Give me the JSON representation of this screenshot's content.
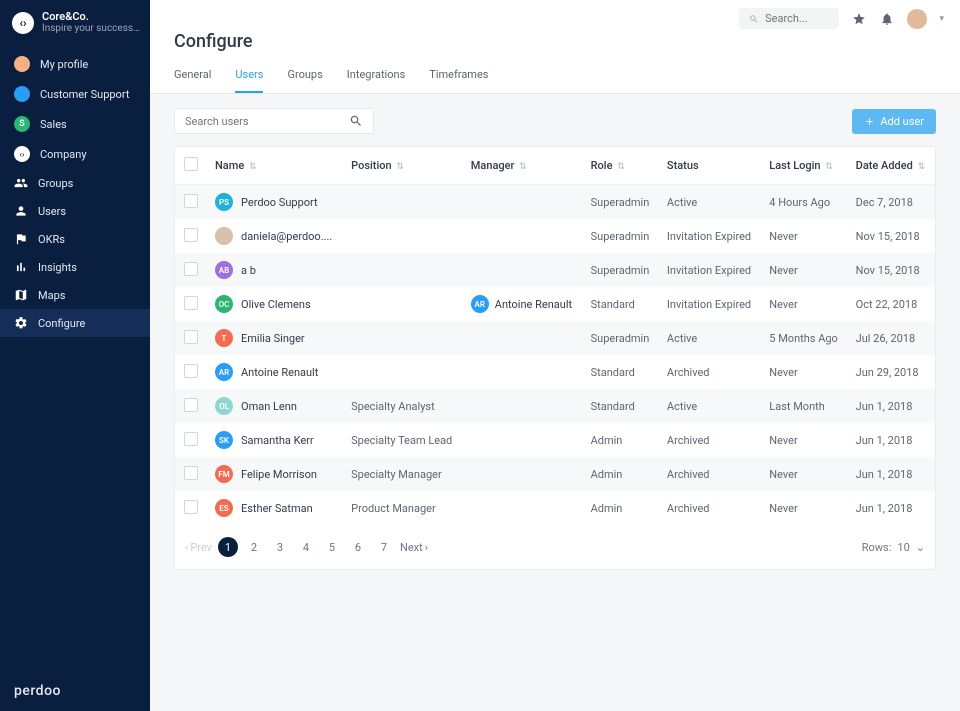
{
  "brand": {
    "name": "Core&Co.",
    "tagline": "Inspire your success ..."
  },
  "sidebar": {
    "items": [
      {
        "label": "My profile",
        "kind": "avatar"
      },
      {
        "label": "Customer Support",
        "kind": "badge",
        "badge_color": "#2a9df4"
      },
      {
        "label": "Sales",
        "kind": "badge",
        "badge_color": "#2bb673",
        "badge_letter": "S"
      },
      {
        "label": "Company",
        "kind": "logo"
      },
      {
        "label": "Groups",
        "kind": "icon",
        "icon": "groups"
      },
      {
        "label": "Users",
        "kind": "icon",
        "icon": "user"
      },
      {
        "label": "OKRs",
        "kind": "icon",
        "icon": "flag"
      },
      {
        "label": "Insights",
        "kind": "icon",
        "icon": "chart"
      },
      {
        "label": "Maps",
        "kind": "icon",
        "icon": "map"
      },
      {
        "label": "Configure",
        "kind": "icon",
        "icon": "gear",
        "active": true
      }
    ],
    "footer_logo": "perdoo"
  },
  "topbar": {
    "search_placeholder": "Search..."
  },
  "page": {
    "title": "Configure"
  },
  "tabs": [
    {
      "label": "General"
    },
    {
      "label": "Users",
      "active": true
    },
    {
      "label": "Groups"
    },
    {
      "label": "Integrations"
    },
    {
      "label": "Timeframes"
    }
  ],
  "toolbar": {
    "search_placeholder": "Search users",
    "add_button_label": "Add user"
  },
  "columns": [
    "Name",
    "Position",
    "Manager",
    "Role",
    "Status",
    "Last Login",
    "Date Added"
  ],
  "sortable": [
    true,
    true,
    true,
    true,
    false,
    true,
    true
  ],
  "rows": [
    {
      "avatar": "#20b0d8",
      "initials": "PS",
      "name": "Perdoo Support",
      "position": "",
      "manager": "",
      "mgr_avatar": "",
      "role": "Superadmin",
      "status": "Active",
      "last_login": "4 Hours Ago",
      "date_added": "Dec 7, 2018"
    },
    {
      "avatar": "photo",
      "initials": "",
      "name": "daniela@perdoo....",
      "position": "",
      "manager": "",
      "mgr_avatar": "",
      "role": "Superadmin",
      "status": "Invitation Expired",
      "last_login": "Never",
      "date_added": "Nov 15, 2018"
    },
    {
      "avatar": "#9d6fe0",
      "initials": "AB",
      "name": "a b",
      "position": "",
      "manager": "",
      "mgr_avatar": "",
      "role": "Superadmin",
      "status": "Invitation Expired",
      "last_login": "Never",
      "date_added": "Nov 15, 2018"
    },
    {
      "avatar": "#2bb673",
      "initials": "OC",
      "name": "Olive Clemens",
      "position": "",
      "manager": "Antoine Renault",
      "mgr_avatar": "#2a9df4",
      "mgr_initials": "AR",
      "role": "Standard",
      "status": "Invitation Expired",
      "last_login": "Never",
      "date_added": "Oct 22, 2018"
    },
    {
      "avatar": "#f26d50",
      "initials": "T",
      "name": "Emilia Singer",
      "position": "",
      "manager": "",
      "mgr_avatar": "",
      "role": "Superadmin",
      "status": "Active",
      "last_login": "5 Months Ago",
      "date_added": "Jul 26, 2018"
    },
    {
      "avatar": "#2a9df4",
      "initials": "AR",
      "name": "Antoine Renault",
      "position": "",
      "manager": "",
      "mgr_avatar": "",
      "role": "Standard",
      "status": "Archived",
      "last_login": "Never",
      "date_added": "Jun 29, 2018"
    },
    {
      "avatar": "#8fd6d2",
      "initials": "OL",
      "name": "Oman Lenn",
      "position": "Specialty Analyst",
      "manager": "",
      "mgr_avatar": "",
      "role": "Standard",
      "status": "Active",
      "last_login": "Last Month",
      "date_added": "Jun 1, 2018"
    },
    {
      "avatar": "#2a9df4",
      "initials": "SK",
      "name": "Samantha Kerr",
      "position": "Specialty Team Lead",
      "manager": "",
      "mgr_avatar": "",
      "role": "Admin",
      "status": "Archived",
      "last_login": "Never",
      "date_added": "Jun 1, 2018"
    },
    {
      "avatar": "#f26d50",
      "initials": "FM",
      "name": "Felipe Morrison",
      "position": "Specialty Manager",
      "manager": "",
      "mgr_avatar": "",
      "role": "Admin",
      "status": "Archived",
      "last_login": "Never",
      "date_added": "Jun 1, 2018"
    },
    {
      "avatar": "#f26d50",
      "initials": "ES",
      "name": "Esther Satman",
      "position": "Product Manager",
      "manager": "",
      "mgr_avatar": "",
      "role": "Admin",
      "status": "Archived",
      "last_login": "Never",
      "date_added": "Jun 1, 2018"
    }
  ],
  "pagination": {
    "prev_label": "Prev",
    "next_label": "Next",
    "pages": [
      "1",
      "2",
      "3",
      "4",
      "5",
      "6",
      "7"
    ],
    "current": "1",
    "rows_label": "Rows:",
    "rows_value": "10"
  }
}
